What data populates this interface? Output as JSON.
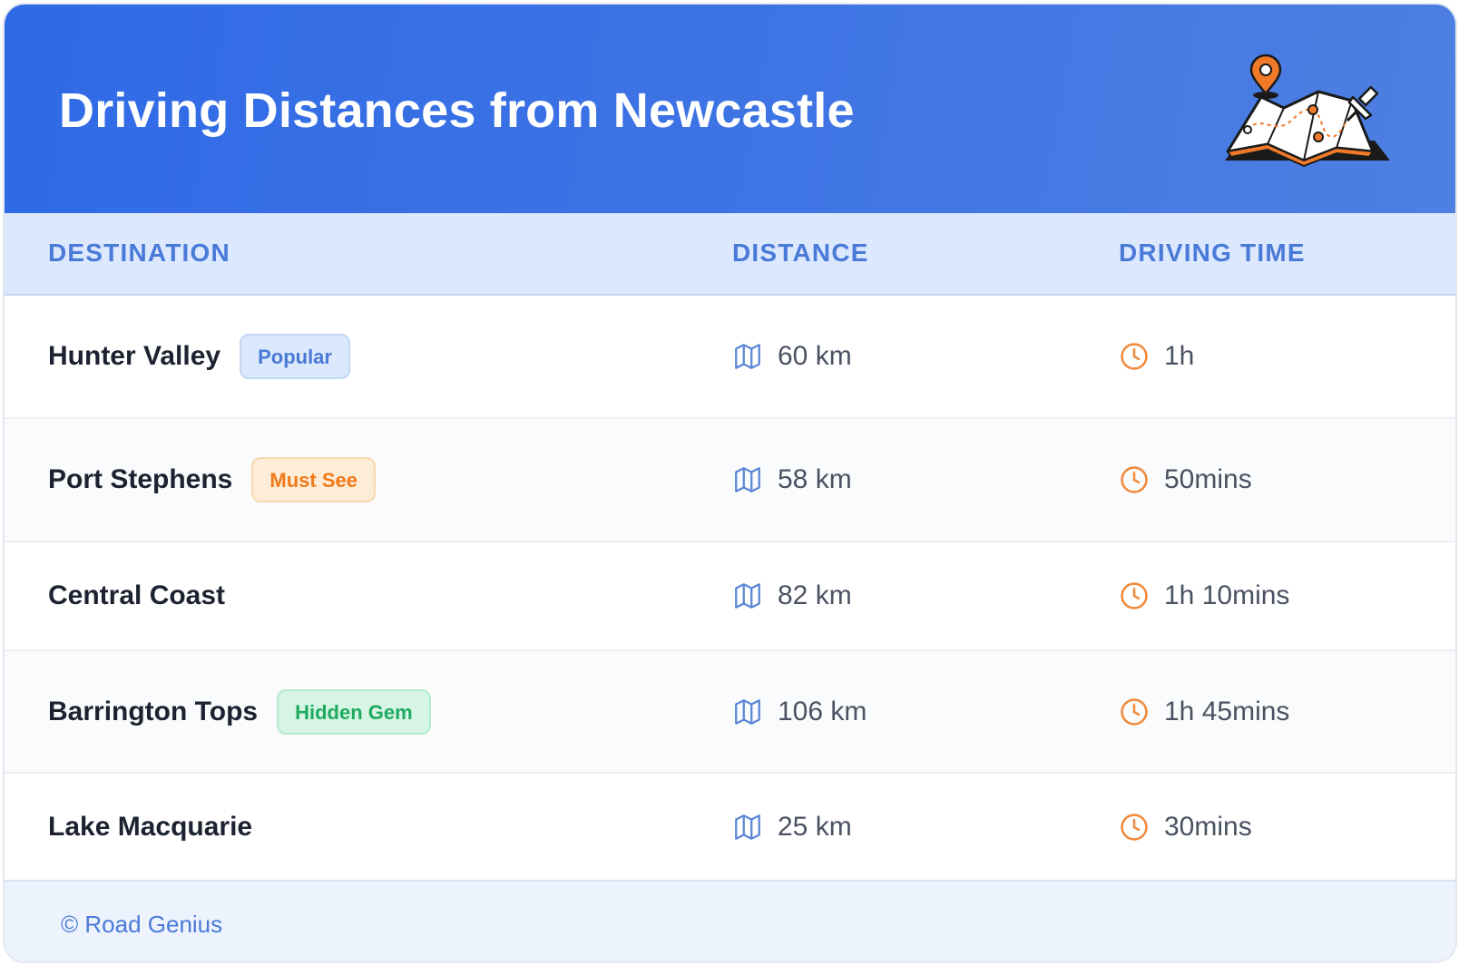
{
  "header": {
    "title": "Driving Distances from Newcastle",
    "illustration_icon": "map-with-pins-icon",
    "gradient_start": "#2f6ae6",
    "gradient_end": "#4e80e2"
  },
  "table": {
    "columns": [
      "DESTINATION",
      "DISTANCE",
      "DRIVING TIME"
    ],
    "distance_icon": "map-icon",
    "time_icon": "clock-icon",
    "rows": [
      {
        "destination": "Hunter Valley",
        "badge": "Popular",
        "badge_color": "blue",
        "distance": "60 km",
        "time": "1h"
      },
      {
        "destination": "Port Stephens",
        "badge": "Must See",
        "badge_color": "orange",
        "distance": "58 km",
        "time": "50mins"
      },
      {
        "destination": "Central Coast",
        "badge": "",
        "badge_color": "",
        "distance": "82 km",
        "time": "1h 10mins"
      },
      {
        "destination": "Barrington Tops",
        "badge": "Hidden Gem",
        "badge_color": "green",
        "distance": "106 km",
        "time": "1h 45mins"
      },
      {
        "destination": "Lake Macquarie",
        "badge": "",
        "badge_color": "",
        "distance": "25 km",
        "time": "30mins"
      }
    ]
  },
  "footer": {
    "credit": "© Road Genius"
  },
  "colors": {
    "accent_blue": "#4a7ad8",
    "clock_orange": "#f08a3c",
    "map_blue": "#5b86d6"
  }
}
